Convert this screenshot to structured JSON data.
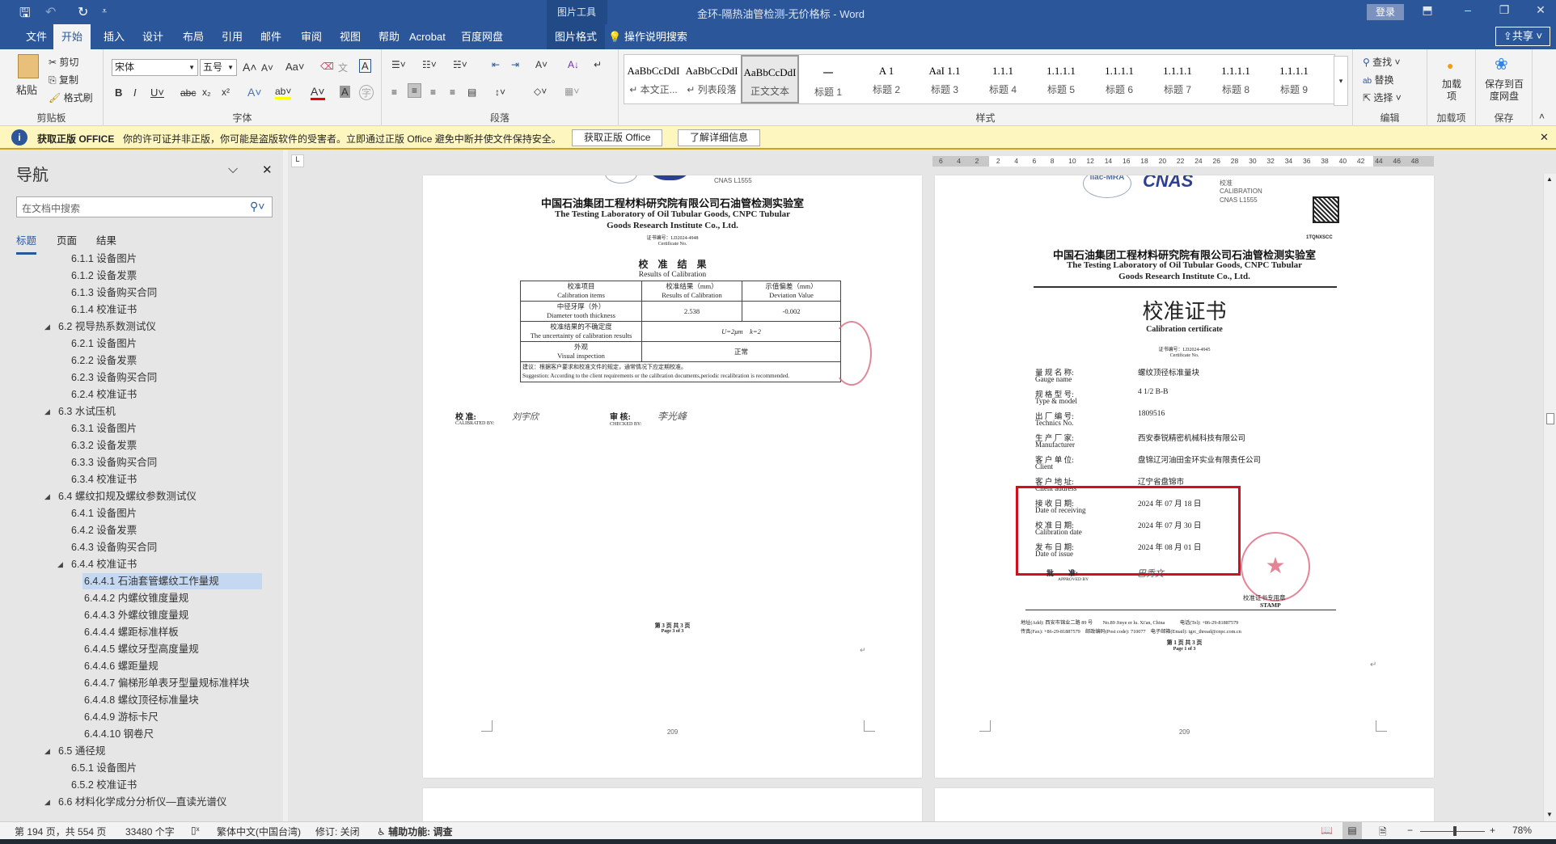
{
  "titlebar": {
    "doc_title": "金环-隔热油管检测-无价格标 - Word",
    "context_tool": "图片工具",
    "signin": "登录",
    "share": "共享"
  },
  "tabs": [
    "文件",
    "开始",
    "插入",
    "设计",
    "布局",
    "引用",
    "邮件",
    "审阅",
    "视图",
    "帮助",
    "Acrobat",
    "百度网盘",
    "图片格式"
  ],
  "tell_me": "操作说明搜索",
  "ribbon": {
    "clipboard": {
      "paste": "粘贴",
      "cut": "剪切",
      "copy": "复制",
      "format_painter": "格式刷",
      "label": "剪贴板"
    },
    "font": {
      "name": "宋体",
      "size": "五号",
      "label": "字体"
    },
    "paragraph": {
      "label": "段落"
    },
    "styles": {
      "label": "样式",
      "items": [
        {
          "preview": "AaBbCcDdI",
          "name": "↵ 本文正..."
        },
        {
          "preview": "AaBbCcDdI",
          "name": "↵ 列表段落"
        },
        {
          "preview": "AaBbCcDdI",
          "name": "正文文本"
        },
        {
          "preview": "一",
          "name": "标题 1"
        },
        {
          "preview": "A  1",
          "name": "标题 2"
        },
        {
          "preview": "AaI 1.1",
          "name": "标题 3"
        },
        {
          "preview": "1.1.1",
          "name": "标题 4"
        },
        {
          "preview": "1.1.1.1",
          "name": "标题 5"
        },
        {
          "preview": "1.1.1.1",
          "name": "标题 6"
        },
        {
          "preview": "1.1.1.1",
          "name": "标题 7"
        },
        {
          "preview": "1.1.1.1",
          "name": "标题 8"
        },
        {
          "preview": "1.1.1.1",
          "name": "标题 9"
        }
      ]
    },
    "editing": {
      "find": "查找",
      "replace": "替换",
      "select": "选择",
      "label": "编辑"
    },
    "addins": {
      "button": "加载项",
      "label": "加载项"
    },
    "save": {
      "button": "保存到百度网盘",
      "label": "保存"
    }
  },
  "notification": {
    "title": "获取正版 OFFICE",
    "message": "你的许可证并非正版，你可能是盗版软件的受害者。立即通过正版 Office 避免中断并使文件保持安全。",
    "btn_get": "获取正版 Office",
    "btn_learn": "了解详细信息"
  },
  "nav": {
    "title": "导航",
    "search_placeholder": "在文档中搜索",
    "tabs": [
      "标题",
      "页面",
      "结果"
    ],
    "items": [
      {
        "t": "6.1.1 设备图片",
        "l": 2
      },
      {
        "t": "6.1.2 设备发票",
        "l": 2
      },
      {
        "t": "6.1.3 设备购买合同",
        "l": 2
      },
      {
        "t": "6.1.4 校准证书",
        "l": 2
      },
      {
        "t": "6.2 视导热系数测试仪",
        "l": 1
      },
      {
        "t": "6.2.1 设备图片",
        "l": 2
      },
      {
        "t": "6.2.2 设备发票",
        "l": 2
      },
      {
        "t": "6.2.3 设备购买合同",
        "l": 2
      },
      {
        "t": "6.2.4 校准证书",
        "l": 2
      },
      {
        "t": "6.3 水试压机",
        "l": 1
      },
      {
        "t": "6.3.1 设备图片",
        "l": 2
      },
      {
        "t": "6.3.2 设备发票",
        "l": 2
      },
      {
        "t": "6.3.3 设备购买合同",
        "l": 2
      },
      {
        "t": "6.3.4 校准证书",
        "l": 2
      },
      {
        "t": "6.4 螺纹扣规及螺纹参数测试仪",
        "l": 1
      },
      {
        "t": "6.4.1 设备图片",
        "l": 2
      },
      {
        "t": "6.4.2 设备发票",
        "l": 2
      },
      {
        "t": "6.4.3 设备购买合同",
        "l": 2
      },
      {
        "t": "6.4.4 校准证书",
        "l": 2,
        "exp": true
      },
      {
        "t": "6.4.4.1 石油套管螺纹工作量规",
        "l": 3,
        "sel": true
      },
      {
        "t": "6.4.4.2 内螺纹锥度量规",
        "l": 3
      },
      {
        "t": "6.4.4.3 外螺纹锥度量规",
        "l": 3
      },
      {
        "t": "6.4.4.4 螺距标准样板",
        "l": 3
      },
      {
        "t": "6.4.4.5 螺纹牙型高度量规",
        "l": 3
      },
      {
        "t": "6.4.4.6 螺距量规",
        "l": 3
      },
      {
        "t": "6.4.4.7 偏梯形单表牙型量规标准样块",
        "l": 3
      },
      {
        "t": "6.4.4.8 螺纹顶径标准量块",
        "l": 3
      },
      {
        "t": "6.4.4.9 游标卡尺",
        "l": 3
      },
      {
        "t": "6.4.4.10 钢卷尺",
        "l": 3
      },
      {
        "t": "6.5 通径规",
        "l": 1
      },
      {
        "t": "6.5.1 设备图片",
        "l": 2
      },
      {
        "t": "6.5.2 校准证书",
        "l": 2
      },
      {
        "t": "6.6 材料化学成分分析仪—直读光谱仪",
        "l": 1
      }
    ]
  },
  "ruler": [
    "6",
    "4",
    "2",
    "2",
    "4",
    "6",
    "8",
    "10",
    "12",
    "14",
    "16",
    "18",
    "20",
    "22",
    "24",
    "26",
    "28",
    "30",
    "32",
    "34",
    "36",
    "38",
    "40",
    "42",
    "44",
    "46",
    "48"
  ],
  "page1": {
    "cnas": "CNAS  L1555",
    "org_cn": "中国石油集团工程材料研究院有限公司石油管检测实验室",
    "org_en1": "The Testing Laboratory of Oil Tubular Goods, CNPC Tubular",
    "org_en2": "Goods Research Institute Co., Ltd.",
    "cert_no": "证书编号：LD2024-4948",
    "cert_no_en": "Certificate No.",
    "results_cn": "校　准　结　果",
    "results_en": "Results of Calibration",
    "table": {
      "h": [
        [
          "校准项目",
          "Calibration items"
        ],
        [
          "校准结果（mm）",
          "Results of Calibration"
        ],
        [
          "示值偏差（mm）",
          "Deviation Value"
        ]
      ],
      "r1": [
        "中径牙厚（外）",
        "Diameter tooth thickness",
        "2.538",
        "-0.002"
      ],
      "r2": [
        "校准结果的不确定度",
        "The uncertainty of calibration results",
        "U=2μm　k=2"
      ],
      "r3": [
        "外观",
        "Visual inspection",
        "正常"
      ],
      "sug_cn": "建议：根据客户要求和校准文件的规定，通常情况下应定期校准。",
      "sug_en": "Suggestion: According to the client requirements or the calibration documents,periodic recalibration is recommended."
    },
    "calibrated_cn": "校 准:",
    "calibrated_en": "CALIBRATED BY:",
    "checked_cn": "审 核:",
    "checked_en": "CHECKED BY:",
    "page_cn": "第 3 页 共 3 页",
    "page_en": "Page 3 of 3",
    "page_num": "209"
  },
  "page2": {
    "logo1": "ilac-MRA",
    "logo2": "CNAS",
    "cal_cn": "校准",
    "cal_en": "CALIBRATION",
    "cnas": "CNAS  L1555",
    "qr_code": "1TQNXSCC",
    "org_cn": "中国石油集团工程材料研究院有限公司石油管检测实验室",
    "org_en1": "The Testing Laboratory of Oil Tubular Goods, CNPC Tubular",
    "org_en2": "Goods Research Institute Co., Ltd.",
    "title_cn": "校准证书",
    "title_en": "Calibration certificate",
    "cert_no": "证书编号：LD2024-4945",
    "cert_no_en": "Certificate No.",
    "fields": [
      {
        "cn": "量 规 名 称:",
        "en": "Gauge name",
        "v": "螺纹顶径标准量块"
      },
      {
        "cn": "规 格 型 号:",
        "en": "Type & model",
        "v": "4 1/2 B-B"
      },
      {
        "cn": "出 厂 编 号:",
        "en": "Technics No.",
        "v": "1809516"
      },
      {
        "cn": "生 产 厂 家:",
        "en": "Manufacturer",
        "v": "西安泰锐精密机械科技有限公司"
      },
      {
        "cn": "客 户 单 位:",
        "en": "Client",
        "v": "盘锦辽河油田金环实业有限责任公司"
      },
      {
        "cn": "客 户 地 址:",
        "en": "Client address",
        "v": "辽宁省盘锦市"
      },
      {
        "cn": "接 收 日 期:",
        "en": "Date of receiving",
        "v": "2024 年 07 月 18 日"
      },
      {
        "cn": "校 准 日 期:",
        "en": "Calibration date",
        "v": "2024 年 07 月 30 日"
      },
      {
        "cn": "发 布 日 期:",
        "en": "Date of issue",
        "v": "2024 年 08 月 01 日"
      }
    ],
    "approved_cn": "批　　准:",
    "approved_en": "APPROVED BY",
    "stamp_cn": "校准证书专用章",
    "stamp_en": "STAMP",
    "addr1": "地址(Add): 西安市锦业二路 89 号　　No.89 Jinye er lu. Xi'an, China　　　电话(Tel): +86-29-81887579",
    "addr2": "传真(Fax): +86-29-81887579　邮政编码(Post code): 710077　电子邮箱(Email): tgrc_thread@cnpc.com.cn",
    "page_cn": "第 1 页 共 3 页",
    "page_en": "Page 1 of 3",
    "page_num": "209"
  },
  "highlight_color": "#d0101e",
  "status": {
    "page": "第 194 页，共 554 页",
    "words": "33480 个字",
    "language": "繁体中文(中国台湾)",
    "track": "修订: 关闭",
    "accessibility": "辅助功能: 调查",
    "zoom": "78%",
    "zoom_value": 78
  }
}
